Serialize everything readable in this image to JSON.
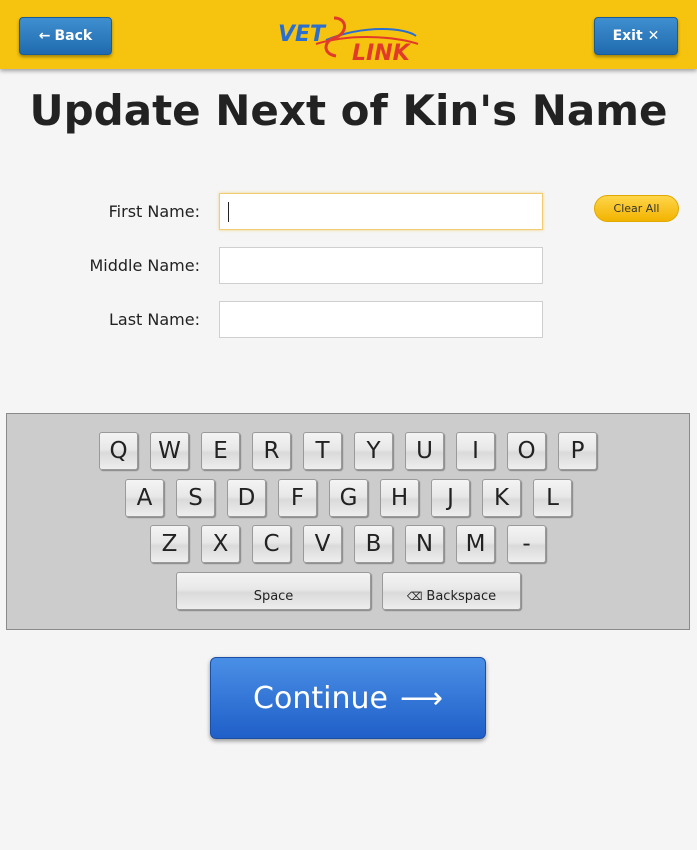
{
  "header": {
    "back_label": "Back",
    "back_icon": "arrow-left-icon",
    "exit_label": "Exit",
    "exit_icon": "close-icon",
    "logo_left": "VET",
    "logo_right": "LINK",
    "brand_color": "#f6c40e",
    "button_color": "#2a78bf"
  },
  "page": {
    "title": "Update Next of Kin's Name"
  },
  "form": {
    "first_name_label": "First Name:",
    "first_name_value": "",
    "middle_name_label": "Middle Name:",
    "middle_name_value": "",
    "last_name_label": "Last Name:",
    "last_name_value": "",
    "clear_all_label": "Clear All"
  },
  "keyboard": {
    "row1": [
      "Q",
      "W",
      "E",
      "R",
      "T",
      "Y",
      "U",
      "I",
      "O",
      "P"
    ],
    "row2": [
      "A",
      "S",
      "D",
      "F",
      "G",
      "H",
      "J",
      "K",
      "L"
    ],
    "row3": [
      "Z",
      "X",
      "C",
      "V",
      "B",
      "N",
      "M",
      "-"
    ],
    "space_label": "Space",
    "backspace_label": "Backspace",
    "backspace_icon": "backspace-icon"
  },
  "continue": {
    "label": "Continue",
    "icon": "arrow-right-icon",
    "color": "#2f72d6"
  }
}
